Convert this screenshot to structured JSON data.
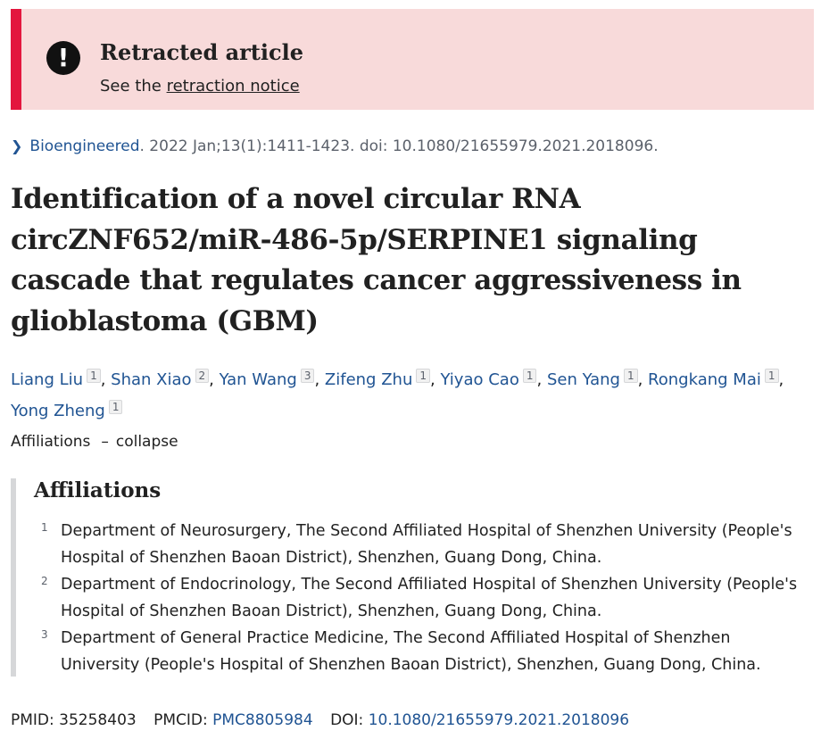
{
  "banner": {
    "icon": "alert-exclamation-icon",
    "title": "Retracted article",
    "sub_prefix": "See the",
    "link": "retraction notice",
    "colors": {
      "background": "#f8dada",
      "accent": "#e3163e"
    }
  },
  "citation": {
    "chevron": "chevron-right-icon",
    "journal": "Bioengineered",
    "details": ". 2022 Jan;13(1):1411-1423. doi: 10.1080/21655979.2021.2018096."
  },
  "title": "Identification of a novel circular RNA circZNF652/miR-486-5p/SERPINE1 signaling cascade that regulates cancer aggressiveness in glioblastoma (GBM)",
  "authors": [
    {
      "name": "Liang Liu",
      "aff": "1"
    },
    {
      "name": "Shan Xiao",
      "aff": "2"
    },
    {
      "name": "Yan Wang",
      "aff": "3"
    },
    {
      "name": "Zifeng Zhu",
      "aff": "1"
    },
    {
      "name": "Yiyao Cao",
      "aff": "1"
    },
    {
      "name": "Sen Yang",
      "aff": "1"
    },
    {
      "name": "Rongkang Mai",
      "aff": "1"
    },
    {
      "name": "Yong Zheng",
      "aff": "1"
    }
  ],
  "affiliations_toggle": {
    "label": "Affiliations",
    "dash": "–",
    "action": "collapse"
  },
  "affiliations": {
    "heading": "Affiliations",
    "items": [
      {
        "num": "1",
        "text": "Department of Neurosurgery, The Second Affiliated Hospital of Shenzhen University (People's Hospital of Shenzhen Baoan District), Shenzhen, Guang Dong, China."
      },
      {
        "num": "2",
        "text": "Department of Endocrinology, The Second Affiliated Hospital of Shenzhen University (People's Hospital of Shenzhen Baoan District), Shenzhen, Guang Dong, China."
      },
      {
        "num": "3",
        "text": "Department of General Practice Medicine, The Second Affiliated Hospital of Shenzhen University (People's Hospital of Shenzhen Baoan District), Shenzhen, Guang Dong, China."
      }
    ]
  },
  "ids": {
    "pmid_label": "PMID:",
    "pmid": "35258403",
    "pmcid_label": "PMCID:",
    "pmcid": "PMC8805984",
    "doi_label": "DOI:",
    "doi": "10.1080/21655979.2021.2018096"
  },
  "colors": {
    "link": "#205493",
    "text": "#212121"
  }
}
